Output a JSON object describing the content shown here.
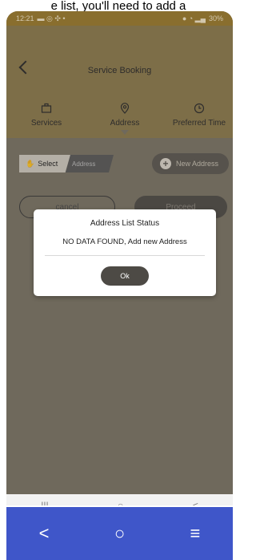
{
  "caption": "e list, you'll need to add a",
  "status_bar": {
    "time": "12:21",
    "right": "30%"
  },
  "header": {
    "title": "Service Booking",
    "steps": [
      {
        "label": "Services",
        "icon": "briefcase-icon"
      },
      {
        "label": "Address",
        "icon": "location-pin-icon"
      },
      {
        "label": "Preferred Time",
        "icon": "clock-icon"
      }
    ]
  },
  "address_controls": {
    "select_label": "Select",
    "address_label": "Address",
    "new_address_label": "New Address"
  },
  "actions": {
    "cancel_label": "cancel",
    "proceed_label": "Proceed"
  },
  "dialog": {
    "title": "Address List Status",
    "message": "NO DATA FOUND, Add new Address",
    "ok_label": "Ok"
  },
  "system_nav": {
    "recents": "|||",
    "home": "○",
    "back": "<"
  },
  "bottom_nav": {
    "back": "<",
    "home": "○",
    "menu": "≡"
  },
  "colors": {
    "header": "#8c7a4e",
    "dialog_button": "#4d4a45",
    "bottom_bar": "#3f56c9"
  }
}
